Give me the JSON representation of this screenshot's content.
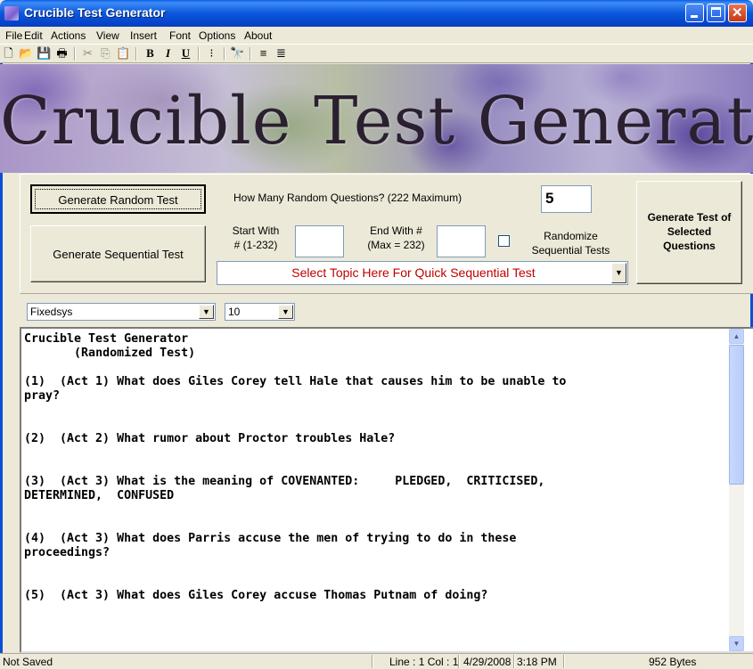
{
  "window": {
    "title": "Crucible Test Generator",
    "minimize_glyph": "—",
    "maximize_glyph": "☐",
    "close_glyph": "✕"
  },
  "menu": {
    "items": [
      "File",
      "Edit",
      "Actions",
      "View",
      "Insert",
      "Font",
      "Options",
      "About"
    ]
  },
  "toolbar": {
    "buttons": [
      {
        "name": "new-icon",
        "glyph": "🗋"
      },
      {
        "name": "open-icon",
        "glyph": "📂"
      },
      {
        "name": "save-icon",
        "glyph": "💾"
      },
      {
        "name": "print-icon",
        "glyph": "🖶"
      },
      {
        "name": "cut-icon",
        "glyph": "✂"
      },
      {
        "name": "copy-icon",
        "glyph": "⎘"
      },
      {
        "name": "paste-icon",
        "glyph": "📋"
      },
      {
        "name": "bold-icon",
        "glyph": "B"
      },
      {
        "name": "italic-icon",
        "glyph": "I"
      },
      {
        "name": "underline-icon",
        "glyph": "U"
      },
      {
        "name": "bullets-icon",
        "glyph": "⁝"
      },
      {
        "name": "find-icon",
        "glyph": "🔭"
      },
      {
        "name": "align-left-icon",
        "glyph": "≡"
      },
      {
        "name": "align-center-icon",
        "glyph": "≣"
      }
    ]
  },
  "banner": {
    "text": "Crucible Test Generator"
  },
  "controls": {
    "generate_random_label": "Generate Random Test",
    "generate_sequential_label": "Generate Sequential Test",
    "generate_selected_label": "Generate Test of Selected Questions",
    "how_many_label": "How Many Random Questions? (222 Maximum)",
    "how_many_value": "5",
    "start_with_label_1": "Start With",
    "start_with_label_2": "# (1-232)",
    "start_with_value": "",
    "end_with_label_1": "End With #",
    "end_with_label_2": "(Max = 232)",
    "end_with_value": "",
    "randomize_label_1": "Randomize",
    "randomize_label_2": "Sequential Tests",
    "randomize_checked": false,
    "topic_placeholder": "Select Topic Here For Quick Sequential Test",
    "topic_color": "#c00000"
  },
  "font": {
    "family_value": "Fixedsys",
    "size_value": "10"
  },
  "document": {
    "text": "Crucible Test Generator\n       (Randomized Test)\n\n(1)  (Act 1) What does Giles Corey tell Hale that causes him to be unable to\npray?\n\n\n(2)  (Act 2) What rumor about Proctor troubles Hale?\n\n\n(3)  (Act 3) What is the meaning of COVENANTED:     PLEDGED,  CRITICISED,\nDETERMINED,  CONFUSED\n\n\n(4)  (Act 3) What does Parris accuse the men of trying to do in these\nproceedings?\n\n\n(5)  (Act 3) What does Giles Corey accuse Thomas Putnam of doing?"
  },
  "status": {
    "save_state": "Not Saved",
    "position": "Line : 1   Col : 1",
    "date": "4/29/2008",
    "time": "3:18 PM",
    "size": "952 Bytes"
  }
}
